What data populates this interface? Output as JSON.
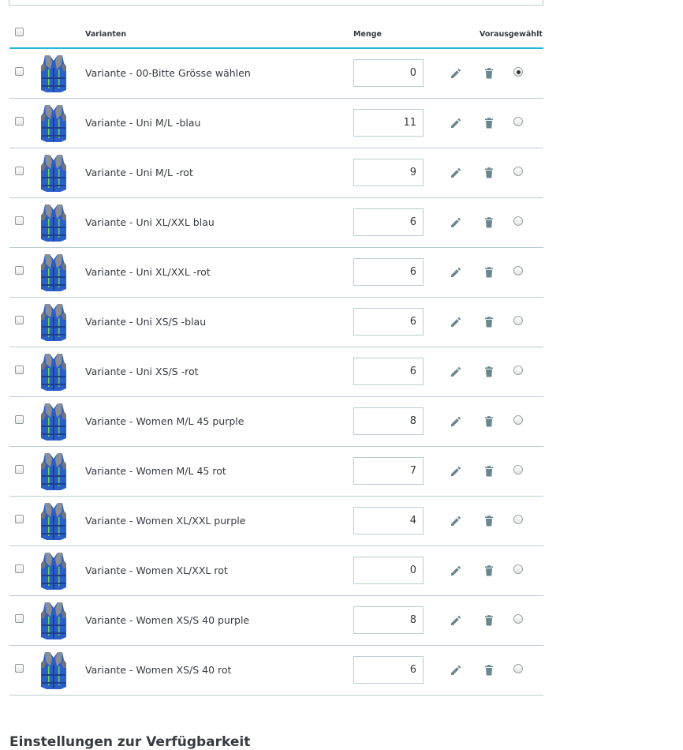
{
  "header": {
    "col_variants": "Varianten",
    "col_quantity": "Menge",
    "col_default": "Vorausgewählt"
  },
  "rows": [
    {
      "name": "Variante - 00-Bitte Grösse wählen",
      "qty": "0",
      "default": true
    },
    {
      "name": "Variante - Uni M/L -blau",
      "qty": "11",
      "default": false
    },
    {
      "name": "Variante - Uni M/L -rot",
      "qty": "9",
      "default": false
    },
    {
      "name": "Variante - Uni XL/XXL blau",
      "qty": "6",
      "default": false
    },
    {
      "name": "Variante - Uni XL/XXL -rot",
      "qty": "6",
      "default": false
    },
    {
      "name": "Variante - Uni XS/S -blau",
      "qty": "6",
      "default": false
    },
    {
      "name": "Variante - Uni XS/S -rot",
      "qty": "6",
      "default": false
    },
    {
      "name": "Variante - Women M/L 45 purple",
      "qty": "8",
      "default": false
    },
    {
      "name": "Variante - Women M/L 45 rot",
      "qty": "7",
      "default": false
    },
    {
      "name": "Variante - Women XL/XXL purple",
      "qty": "4",
      "default": false
    },
    {
      "name": "Variante - Women XL/XXL rot",
      "qty": "0",
      "default": false
    },
    {
      "name": "Variante - Women XS/S 40 purple",
      "qty": "8",
      "default": false
    },
    {
      "name": "Variante - Women XS/S 40 rot",
      "qty": "6",
      "default": false
    }
  ],
  "icons": {
    "edit": "pencil-icon",
    "delete": "trash-icon",
    "thumbnail": "life-vest-image"
  },
  "colors": {
    "accent": "#25b9d7",
    "icon": "#6c868e",
    "vest_blue": "#2b5fc7"
  },
  "footer": {
    "section_title": "Einstellungen zur Verfügbarkeit"
  }
}
